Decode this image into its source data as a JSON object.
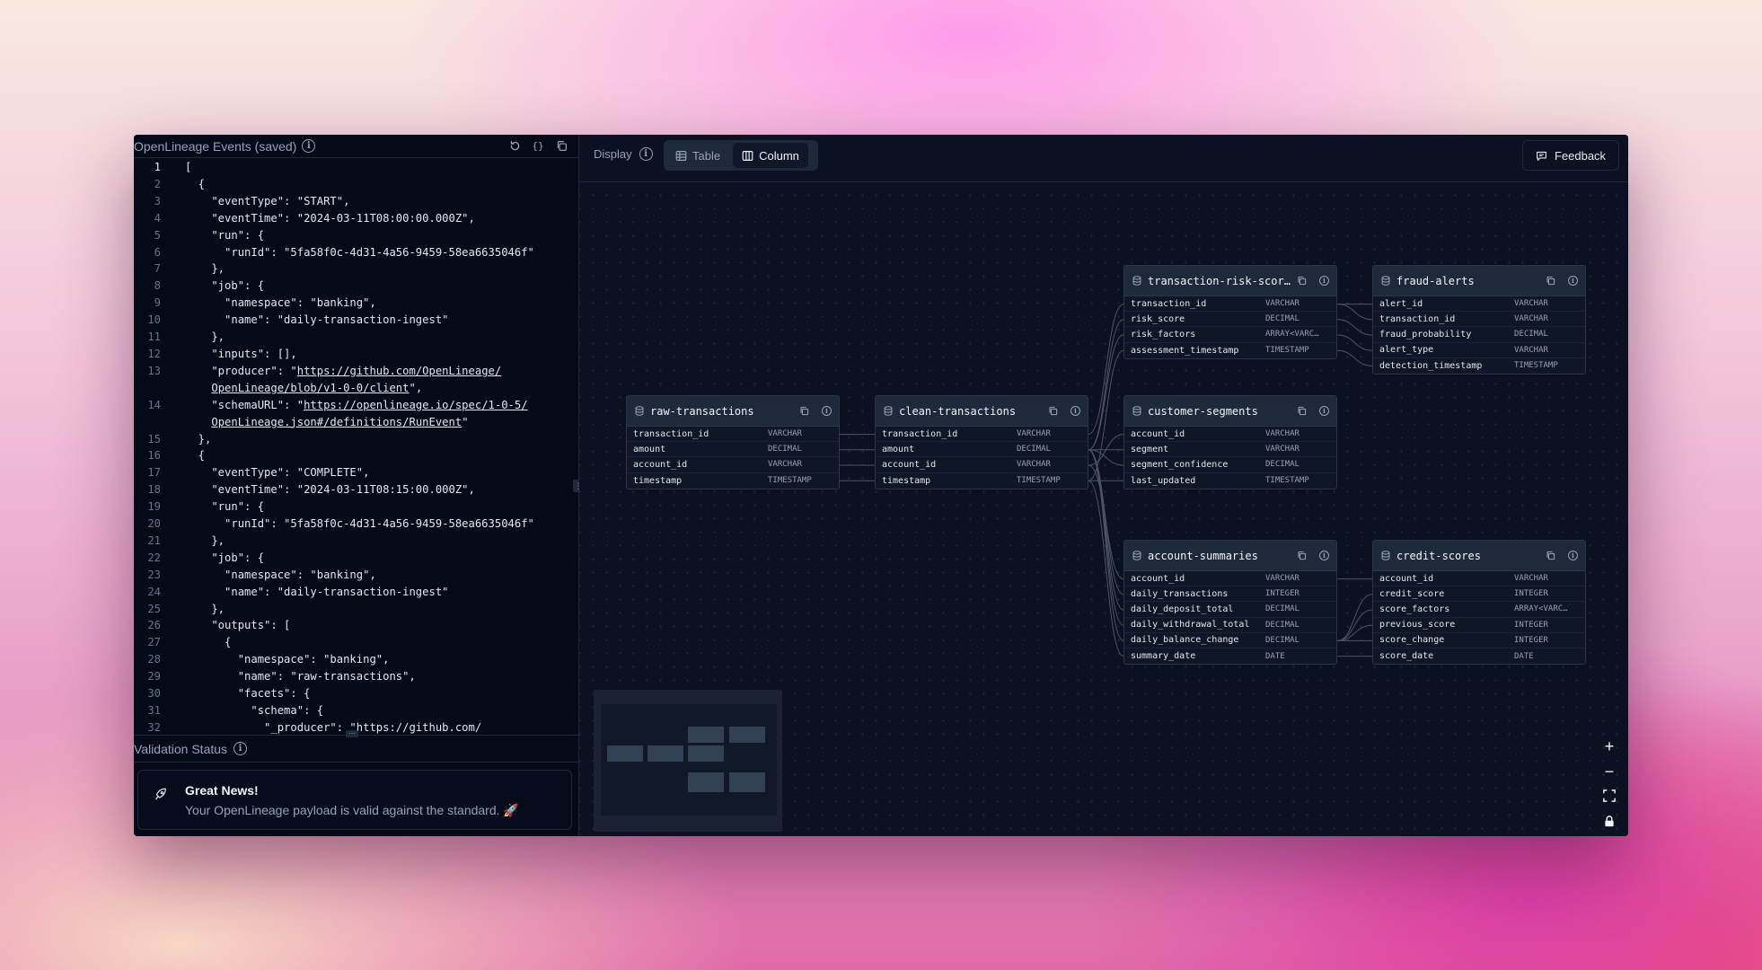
{
  "left_panel": {
    "title": "OpenLineage Events (saved)",
    "code_lines": [
      {
        "n": "1",
        "text": "["
      },
      {
        "n": "2",
        "text": "  {"
      },
      {
        "n": "3",
        "text": "    \"eventType\": \"START\","
      },
      {
        "n": "4",
        "text": "    \"eventTime\": \"2024-03-11T08:00:00.000Z\","
      },
      {
        "n": "5",
        "text": "    \"run\": {"
      },
      {
        "n": "6",
        "text": "      \"runId\": \"5fa58f0c-4d31-4a56-9459-58ea6635046f\""
      },
      {
        "n": "7",
        "text": "    },"
      },
      {
        "n": "8",
        "text": "    \"job\": {"
      },
      {
        "n": "9",
        "text": "      \"namespace\": \"banking\","
      },
      {
        "n": "10",
        "text": "      \"name\": \"daily-transaction-ingest\""
      },
      {
        "n": "11",
        "text": "    },"
      },
      {
        "n": "12",
        "text": "    \"inputs\": [],"
      },
      {
        "n": "13",
        "text": "    \"producer\": \"",
        "link": "https://github.com/OpenLineage/",
        "link2": "OpenLineage/blob/v1-0-0/client",
        "tail": "\","
      },
      {
        "n": "14",
        "text": "    \"schemaURL\": \"",
        "link": "https://openlineage.io/spec/1-0-5/",
        "link2": "OpenLineage.json#/definitions/RunEvent",
        "tail": "\""
      },
      {
        "n": "15",
        "text": "  },"
      },
      {
        "n": "16",
        "text": "  {"
      },
      {
        "n": "17",
        "text": "    \"eventType\": \"COMPLETE\","
      },
      {
        "n": "18",
        "text": "    \"eventTime\": \"2024-03-11T08:15:00.000Z\","
      },
      {
        "n": "19",
        "text": "    \"run\": {"
      },
      {
        "n": "20",
        "text": "      \"runId\": \"5fa58f0c-4d31-4a56-9459-58ea6635046f\""
      },
      {
        "n": "21",
        "text": "    },"
      },
      {
        "n": "22",
        "text": "    \"job\": {"
      },
      {
        "n": "23",
        "text": "      \"namespace\": \"banking\","
      },
      {
        "n": "24",
        "text": "      \"name\": \"daily-transaction-ingest\""
      },
      {
        "n": "25",
        "text": "    },"
      },
      {
        "n": "26",
        "text": "    \"outputs\": ["
      },
      {
        "n": "27",
        "text": "      {"
      },
      {
        "n": "28",
        "text": "        \"namespace\": \"banking\","
      },
      {
        "n": "29",
        "text": "        \"name\": \"raw-transactions\","
      },
      {
        "n": "30",
        "text": "        \"facets\": {"
      },
      {
        "n": "31",
        "text": "          \"schema\": {"
      },
      {
        "n": "32",
        "text": "            \"_producer\": \"https://github.com/"
      }
    ],
    "validation": {
      "title": "Validation Status",
      "heading": "Great News!",
      "message": "Your OpenLineage payload is valid against the standard. 🚀"
    }
  },
  "toolbar": {
    "display_label": "Display",
    "table_label": "Table",
    "column_label": "Column",
    "active_view": "Column",
    "feedback_label": "Feedback"
  },
  "nodes": [
    {
      "id": "raw-transactions",
      "title": "raw-transactions",
      "columns": [
        {
          "name": "transaction_id",
          "type": "VARCHAR"
        },
        {
          "name": "amount",
          "type": "DECIMAL"
        },
        {
          "name": "account_id",
          "type": "VARCHAR"
        },
        {
          "name": "timestamp",
          "type": "TIMESTAMP"
        }
      ]
    },
    {
      "id": "clean-transactions",
      "title": "clean-transactions",
      "columns": [
        {
          "name": "transaction_id",
          "type": "VARCHAR"
        },
        {
          "name": "amount",
          "type": "DECIMAL"
        },
        {
          "name": "account_id",
          "type": "VARCHAR"
        },
        {
          "name": "timestamp",
          "type": "TIMESTAMP"
        }
      ]
    },
    {
      "id": "transaction-risk-scores",
      "title": "transaction-risk-scor…",
      "columns": [
        {
          "name": "transaction_id",
          "type": "VARCHAR"
        },
        {
          "name": "risk_score",
          "type": "DECIMAL"
        },
        {
          "name": "risk_factors",
          "type": "ARRAY<VARC…"
        },
        {
          "name": "assessment_timestamp",
          "type": "TIMESTAMP"
        }
      ]
    },
    {
      "id": "fraud-alerts",
      "title": "fraud-alerts",
      "columns": [
        {
          "name": "alert_id",
          "type": "VARCHAR"
        },
        {
          "name": "transaction_id",
          "type": "VARCHAR"
        },
        {
          "name": "fraud_probability",
          "type": "DECIMAL"
        },
        {
          "name": "alert_type",
          "type": "VARCHAR"
        },
        {
          "name": "detection_timestamp",
          "type": "TIMESTAMP"
        }
      ]
    },
    {
      "id": "customer-segments",
      "title": "customer-segments",
      "columns": [
        {
          "name": "account_id",
          "type": "VARCHAR"
        },
        {
          "name": "segment",
          "type": "VARCHAR"
        },
        {
          "name": "segment_confidence",
          "type": "DECIMAL"
        },
        {
          "name": "last_updated",
          "type": "TIMESTAMP"
        }
      ]
    },
    {
      "id": "account-summaries",
      "title": "account-summaries",
      "columns": [
        {
          "name": "account_id",
          "type": "VARCHAR"
        },
        {
          "name": "daily_transactions",
          "type": "INTEGER"
        },
        {
          "name": "daily_deposit_total",
          "type": "DECIMAL"
        },
        {
          "name": "daily_withdrawal_total",
          "type": "DECIMAL"
        },
        {
          "name": "daily_balance_change",
          "type": "DECIMAL"
        },
        {
          "name": "summary_date",
          "type": "DATE"
        }
      ]
    },
    {
      "id": "credit-scores",
      "title": "credit-scores",
      "columns": [
        {
          "name": "account_id",
          "type": "VARCHAR"
        },
        {
          "name": "credit_score",
          "type": "INTEGER"
        },
        {
          "name": "score_factors",
          "type": "ARRAY<VARC…"
        },
        {
          "name": "previous_score",
          "type": "INTEGER"
        },
        {
          "name": "score_change",
          "type": "INTEGER"
        },
        {
          "name": "score_date",
          "type": "DATE"
        }
      ]
    }
  ],
  "zoom_controls": [
    "zoom-in",
    "zoom-out",
    "fit-view",
    "lock"
  ]
}
